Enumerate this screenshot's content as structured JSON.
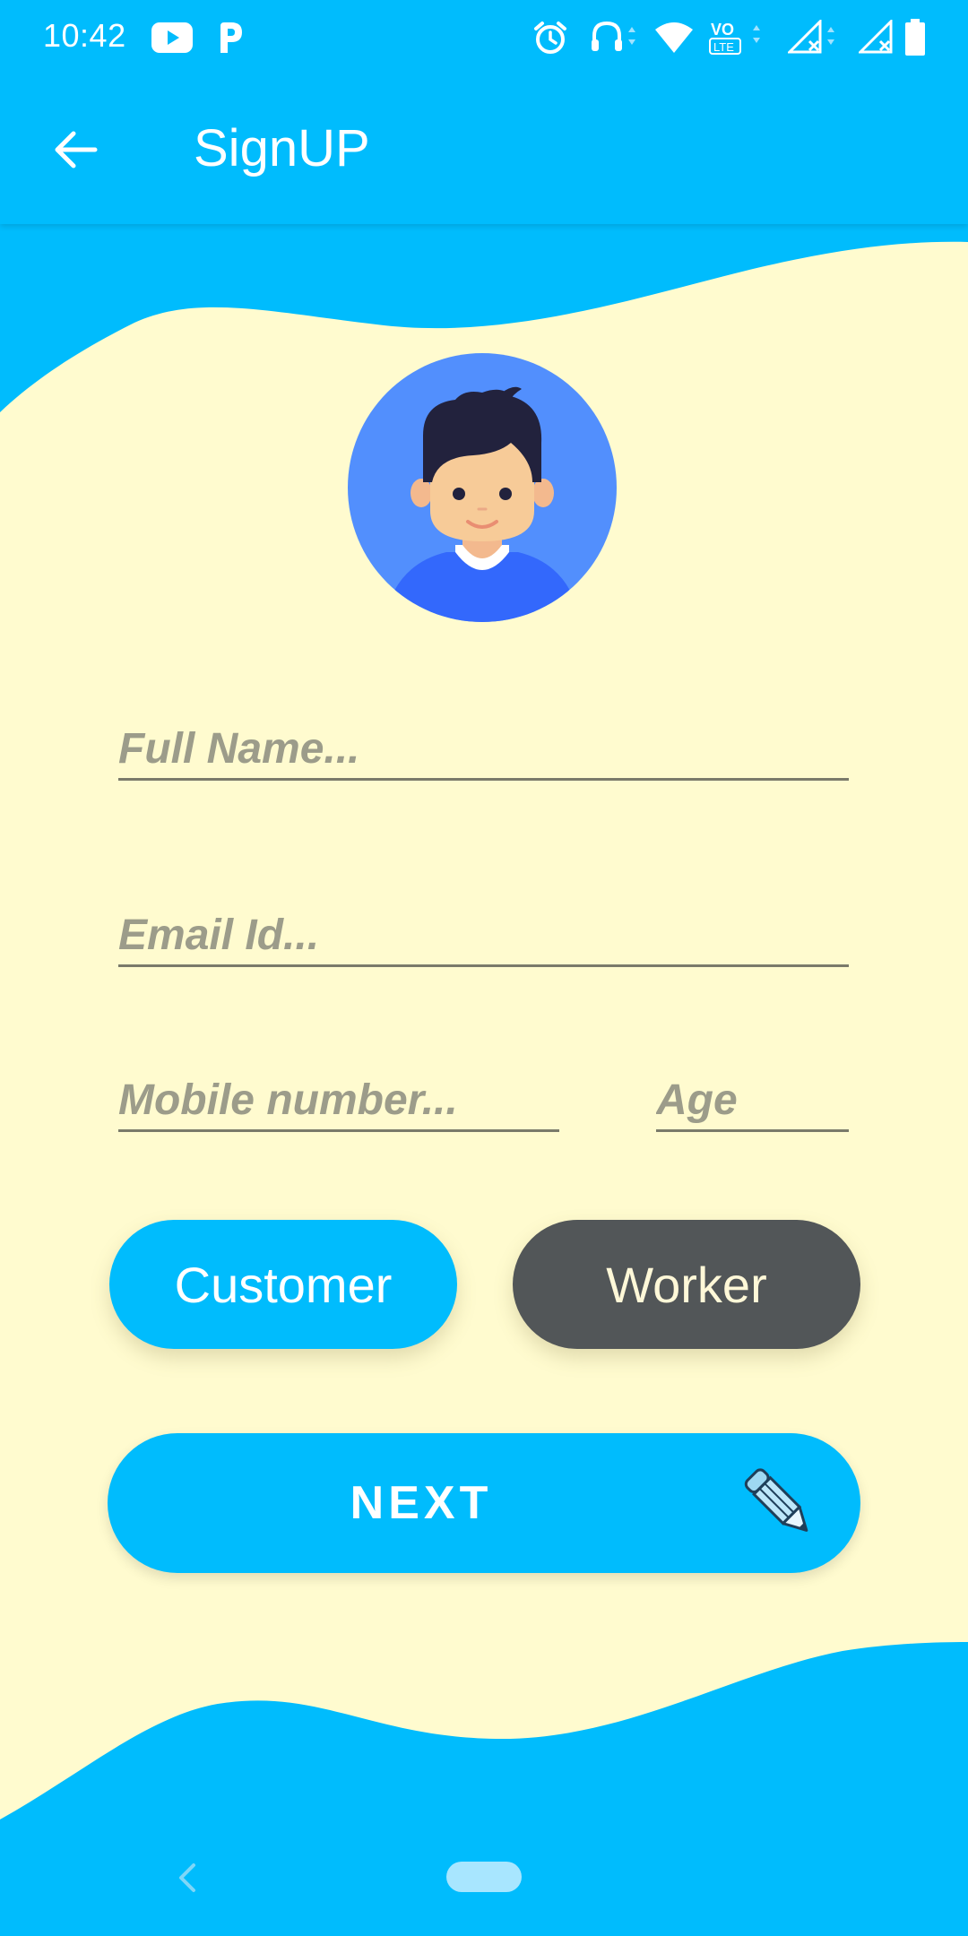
{
  "status_bar": {
    "time": "10:42",
    "left_icons": [
      "youtube-icon",
      "parking-p-icon"
    ],
    "right_icons": [
      "alarm-icon",
      "headset-icon",
      "wifi-icon",
      "volte-icon",
      "cell-signal-icon",
      "cell-signal-icon",
      "battery-icon"
    ],
    "volte_label": "VO",
    "lte_label": "LTE"
  },
  "app_bar": {
    "back_icon": "arrow-left-icon",
    "title": "SignUP"
  },
  "avatar": {
    "icon": "user-avatar-icon"
  },
  "form": {
    "full_name": {
      "placeholder": "Full Name...",
      "value": ""
    },
    "email": {
      "placeholder": "Email Id...",
      "value": ""
    },
    "mobile": {
      "placeholder": "Mobile number...",
      "value": ""
    },
    "age": {
      "placeholder": "Age",
      "value": ""
    }
  },
  "roles": {
    "customer_label": "Customer",
    "worker_label": "Worker"
  },
  "next_button": {
    "label": "NEXT",
    "icon": "pencil-icon"
  },
  "nav_bar": {
    "back_icon": "chevron-left-icon",
    "home_icon": "home-pill-icon"
  },
  "colors": {
    "primary": "#00BCFD",
    "background": "#FFFBCF",
    "worker_button": "#525658",
    "input_line": "#7a7a6a",
    "placeholder": "#9c9c8a"
  }
}
